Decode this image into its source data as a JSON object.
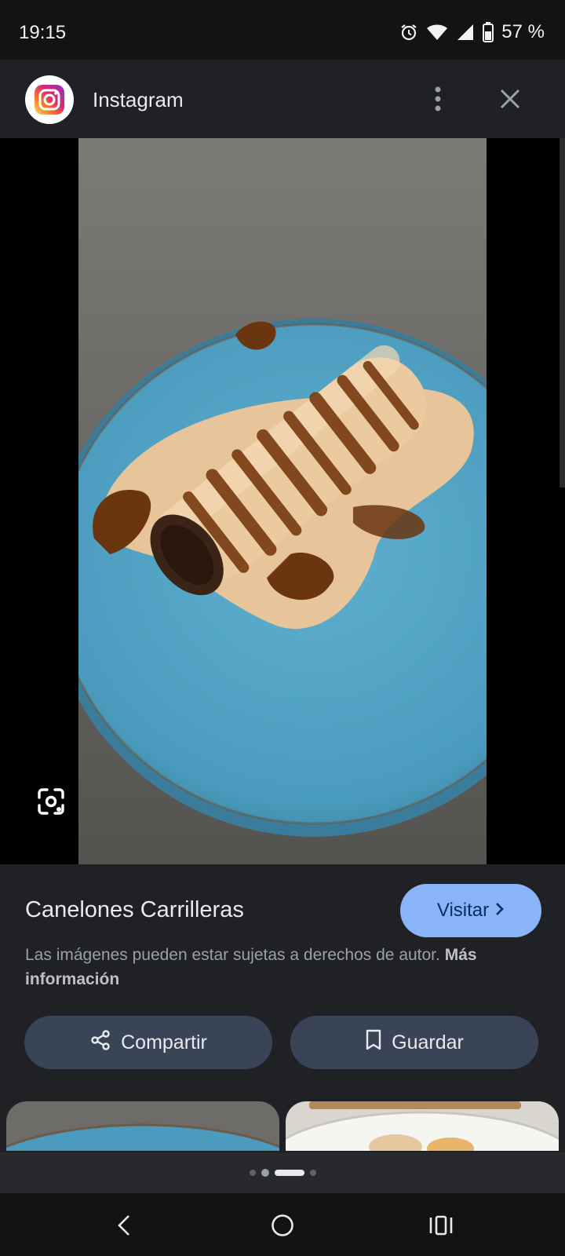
{
  "status_bar": {
    "time": "19:15",
    "battery": "57 %",
    "icons": [
      "alarm-icon",
      "wifi-icon",
      "signal-icon",
      "battery-icon"
    ]
  },
  "header": {
    "source_name": "Instagram",
    "logo_icon": "instagram-logo",
    "more_icon": "more-vert-icon",
    "close_icon": "close-icon"
  },
  "viewer": {
    "lens_icon": "google-lens-icon"
  },
  "result": {
    "title": "Canelones Carrilleras",
    "visit_label": "Visitar",
    "copyright_text": "Las imágenes pueden estar sujetas a derechos de autor.",
    "more_info_label": "Más información",
    "share_label": "Compartir",
    "save_label": "Guardar"
  },
  "pager": {
    "count": 4,
    "active_index": 2
  },
  "nav_bar": {
    "icons": [
      "back-icon",
      "home-icon",
      "recents-icon"
    ]
  },
  "colors": {
    "background": "#202124",
    "accent": "#8ab4f8",
    "pill": "#394457",
    "plate": "#4e9ec0"
  }
}
